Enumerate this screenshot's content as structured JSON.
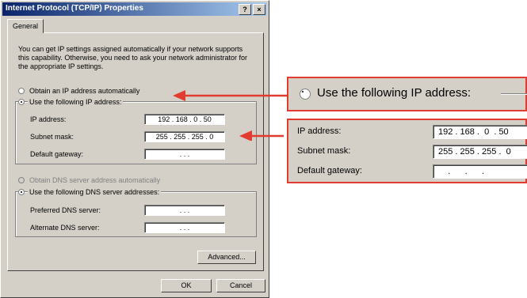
{
  "dialog": {
    "title": "Internet Protocol (TCP/IP) Properties",
    "help_button": "?",
    "close_button": "×",
    "tab_general": "General",
    "description": "You can get IP settings assigned automatically if your network supports this capability. Otherwise, you need to ask your network administrator for the appropriate IP settings.",
    "obtain_ip_auto": "Obtain an IP address automatically",
    "use_following_ip": "Use the following IP address:",
    "ip_label": "IP address:",
    "ip_value": "192 . 168 .  0  . 50",
    "subnet_label": "Subnet mask:",
    "subnet_value": "255 . 255 . 255 .  0",
    "gateway_label": "Default gateway:",
    "gateway_value": " .       .       . ",
    "obtain_dns_auto": "Obtain DNS server address automatically",
    "use_following_dns": "Use the following DNS server addresses:",
    "preferred_dns_label": "Preferred DNS server:",
    "preferred_dns_value": " .       .       . ",
    "alternate_dns_label": "Alternate DNS server:",
    "alternate_dns_value": " .       .       . ",
    "advanced_button": "Advanced...",
    "ok_button": "OK",
    "cancel_button": "Cancel"
  },
  "zoom_top": {
    "label": "Use the following IP address:"
  },
  "zoom_fields": {
    "ip_label": "IP address:",
    "ip_value": "192 . 168 .  0  . 50",
    "subnet_label": "Subnet mask:",
    "subnet_value": "255 . 255 . 255 .  0",
    "gateway_label": "Default gateway:",
    "gateway_value": "    .      .      ."
  },
  "colors": {
    "annotation": "#e23b2f",
    "title_bar": "#0a246a",
    "window": "#d4d0c8"
  }
}
